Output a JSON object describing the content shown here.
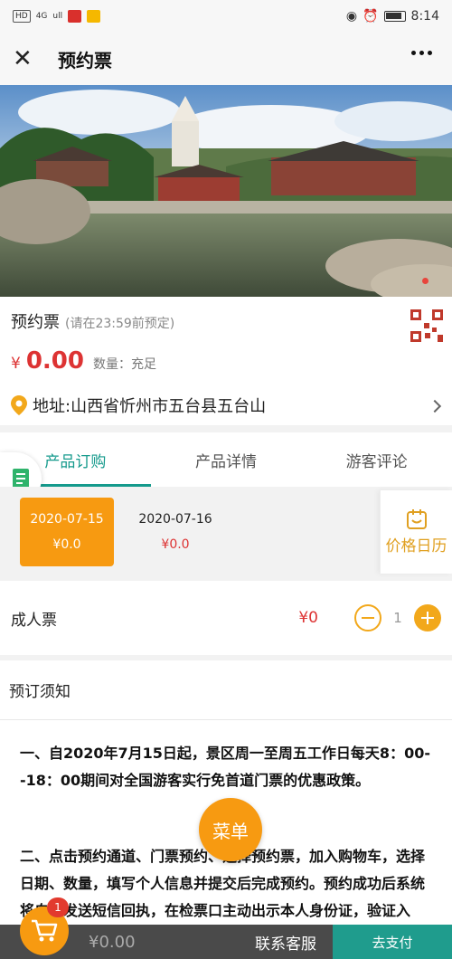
{
  "status_bar": {
    "left": [
      "HD",
      "4G",
      "ull"
    ],
    "time": "8:14"
  },
  "nav": {
    "title": "预约票"
  },
  "product": {
    "title": "预约票",
    "hint": "(请在23:59前预定)",
    "currency": "¥",
    "price": "0.00",
    "quantity": "数量：充足",
    "address": "地址:山西省忻州市五台县五台山"
  },
  "tabs": [
    {
      "label": "产品订购",
      "active": true
    },
    {
      "label": "产品详情",
      "active": false
    },
    {
      "label": "游客评论",
      "active": false
    }
  ],
  "dates": [
    {
      "date": "2020-07-15",
      "price": "¥0.0",
      "selected": true
    },
    {
      "date": "2020-07-16",
      "price": "¥0.0",
      "selected": false
    }
  ],
  "calendar_label": "价格日历",
  "ticket": {
    "name": "成人票",
    "price": "¥0",
    "count": "1"
  },
  "notice": {
    "heading": "预订须知",
    "para1": "一、自2020年7月15日起，景区周一至周五工作日每天8：00--18：00期间对全国游客实行免首道门票的优惠政策。",
    "para2": "二、点击预约通道、门票预约、选择预约票，加入购物车，选择日期、数量，填写个人信息并提交后完成预约。预约成功后系统将自动发送短信回执，在检票口主动出示本人身份证，验证入山。"
  },
  "menu_label": "菜单",
  "bottom": {
    "badge": "1",
    "total": "¥0.00",
    "service": "联系客服",
    "pay": "去支付"
  },
  "colors": {
    "accent_orange": "#f79a11",
    "accent_teal": "#159a8c",
    "price_red": "#d33333"
  }
}
